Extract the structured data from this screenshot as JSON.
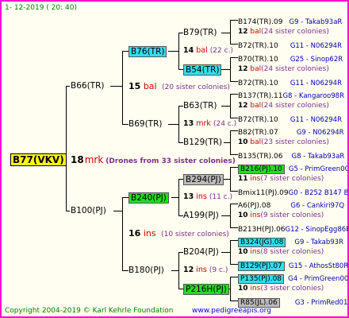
{
  "header": {
    "date": "1-  12-2019  ( 20:  40)"
  },
  "root": {
    "name": "B77(VKV)",
    "num": "18",
    "mark": "mrk",
    "note": "(Drones from 33 sister colonies)"
  },
  "gen1": [
    {
      "name": "B66(TR)",
      "num": "15",
      "mark": "bal",
      "note": "(20 sister colonies)"
    },
    {
      "name": "B100(PJ)",
      "num": "16",
      "mark": "ins",
      "note": "(10 sister colonies)"
    }
  ],
  "gen2": [
    {
      "name": "B76(TR)",
      "num": "14",
      "mark": "bal",
      "note": "(22 c.)"
    },
    {
      "name": "B69(TR)",
      "num": "13",
      "mark": "mrk",
      "note": "(24 c.)"
    },
    {
      "name": "B240(PJ)",
      "num": "13",
      "mark": "ins",
      "note": "(11 c.)"
    },
    {
      "name": "B180(PJ)",
      "num": "12",
      "mark": "ins",
      "note": "(9 c.)"
    }
  ],
  "gen3": [
    {
      "name": "B79(TR)"
    },
    {
      "name": "B54(TR)"
    },
    {
      "name": "B63(TR)"
    },
    {
      "name": "B129(TR)"
    },
    {
      "name": "B294(PJ)"
    },
    {
      "name": "A199(PJ)"
    },
    {
      "name": "B204(PJ)"
    },
    {
      "name": "P216H(PJ)"
    }
  ],
  "gen4": [
    {
      "l": "B174(TR).09",
      "r": "G9 - Takab93aR"
    },
    {
      "c": "12",
      "m": "bal",
      "n": "(24 sister colonies)"
    },
    {
      "l": "B72(TR).10",
      "r": "G11 - N06294R"
    },
    {
      "l": "B70(TR).10",
      "r": "G25 - Sinop62R"
    },
    {
      "c": "12",
      "m": "bal",
      "n": "(24 sister colonies)"
    },
    {
      "l": "B72(TR).10",
      "r": "G11 - N06294R"
    },
    {
      "l": "B137(TR).11",
      "r": "G8 - Kangaroo98R"
    },
    {
      "c": "12",
      "m": "bal",
      "n": "(24 sister colonies)"
    },
    {
      "l": "B72(TR).10",
      "r": "G11 - N06294R"
    },
    {
      "l": "B82(TR).07",
      "r": "G9 - N06294R"
    },
    {
      "c": "10",
      "m": "bal",
      "n": "(23 sister colonies)"
    },
    {
      "l": "B135(TR).06",
      "r": "G8 - Takab93aR"
    },
    {
      "l": "B216(PJ).10",
      "r": "G5 - PrimGreen00"
    },
    {
      "c": "11",
      "m": "ins",
      "n": "(7 sister colonies)"
    },
    {
      "l": "Bmix11(PJ).09",
      "r": "G0 - B252 B147 B"
    },
    {
      "l": "A6(PJ).08",
      "r": "G6 - Cankiri97Q"
    },
    {
      "c": "10",
      "m": "ins",
      "n": "(9 sister colonies)"
    },
    {
      "l": "B213H(PJ).06",
      "r": "G12 - SinopEgg86R"
    },
    {
      "l": "B324(JG).08",
      "r": "G9 - Takab93R"
    },
    {
      "c": "10",
      "m": "ins",
      "n": "(8 sister colonies)"
    },
    {
      "l": "B129(PJ).07",
      "r": "G15 - AthosSt80R"
    },
    {
      "l": "P135(PJ).08",
      "r": "G4 - PrimGreen00"
    },
    {
      "c": "10",
      "m": "ins",
      "n": "(3 sister colonies)"
    },
    {
      "l": "R85(JL).06",
      "r": "G3 - PrimRed01"
    }
  ],
  "footer": {
    "copyright": "Copyright 2004-2019 © Karl Kehrle Foundation",
    "url": "www.pedigreeapis.org"
  }
}
